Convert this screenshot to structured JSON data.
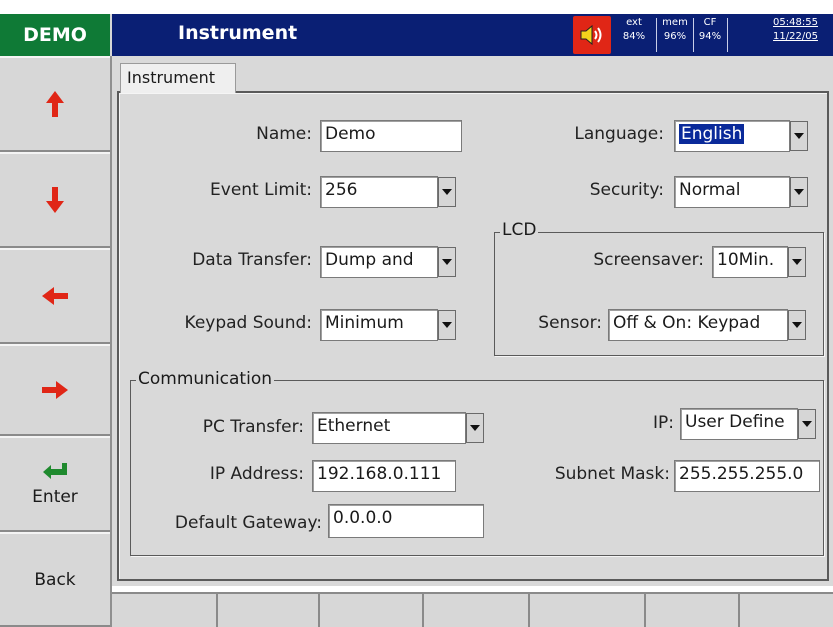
{
  "app": {
    "badge": "DEMO",
    "title": "Instrument"
  },
  "status": {
    "ext_label": "ext",
    "ext_value": "84%",
    "mem_label": "mem",
    "mem_value": "96%",
    "cf_label": "CF",
    "cf_value": "94%",
    "time": "05:48:55",
    "date": "11/22/05"
  },
  "nav": {
    "up_icon": "arrow-up-icon",
    "down_icon": "arrow-down-icon",
    "left_icon": "arrow-left-icon",
    "right_icon": "arrow-right-icon",
    "enter_label": "Enter",
    "back_label": "Back"
  },
  "tab": {
    "label": "Instrument"
  },
  "form": {
    "name_label": "Name:",
    "name_value": "Demo",
    "event_limit_label": "Event Limit:",
    "event_limit_value": "256",
    "data_transfer_label": "Data Transfer:",
    "data_transfer_value": "Dump and",
    "keypad_sound_label": "Keypad Sound:",
    "keypad_sound_value": "Minimum",
    "language_label": "Language:",
    "language_value": "English",
    "security_label": "Security:",
    "security_value": "Normal"
  },
  "lcd": {
    "legend": "LCD",
    "screensaver_label": "Screensaver:",
    "screensaver_value": "10Min.",
    "sensor_label": "Sensor:",
    "sensor_value": "Off & On: Keypad"
  },
  "communication": {
    "legend": "Communication",
    "pc_transfer_label": "PC Transfer:",
    "pc_transfer_value": "Ethernet",
    "ip_mode_label": "IP:",
    "ip_mode_value": "User Define",
    "ip_address_label": "IP Address:",
    "ip_address_value": "192.168.0.111",
    "subnet_mask_label": "Subnet Mask:",
    "subnet_mask_value": "255.255.255.0",
    "gateway_label": "Default Gateway:",
    "gateway_value": "0.0.0.0"
  },
  "colors": {
    "title_bar": "#0a1f74",
    "badge": "#0f7a36",
    "speaker": "#e02616",
    "arrow_red": "#e02616",
    "enter_green": "#1f8a2e",
    "highlight": "#0a2a9a"
  }
}
